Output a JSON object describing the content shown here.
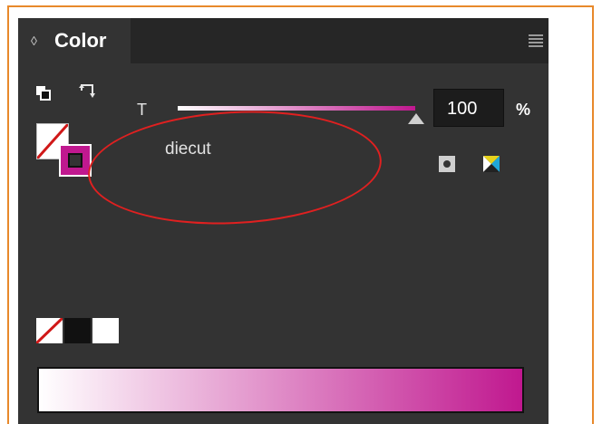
{
  "panel": {
    "tab_label": "Color",
    "tab_arrows_glyph": "◊",
    "menu_icon": "panel-menu-icon"
  },
  "tint": {
    "letter": "T",
    "value": "100",
    "unit": "%",
    "level_percent": 100
  },
  "swatch": {
    "name": "diecut",
    "color": "#c0188f"
  },
  "icons": {
    "default_fill_stroke": "default-fill-stroke-icon",
    "swap_fill_stroke": "swap-fill-stroke-icon",
    "spot_mode": "spot-color-mode-icon",
    "cmyk_mode": "cmyk-mode-icon"
  },
  "colors": {
    "accent_frame": "#e8892b",
    "annotation": "#e02020",
    "panel_bg": "#333333"
  }
}
